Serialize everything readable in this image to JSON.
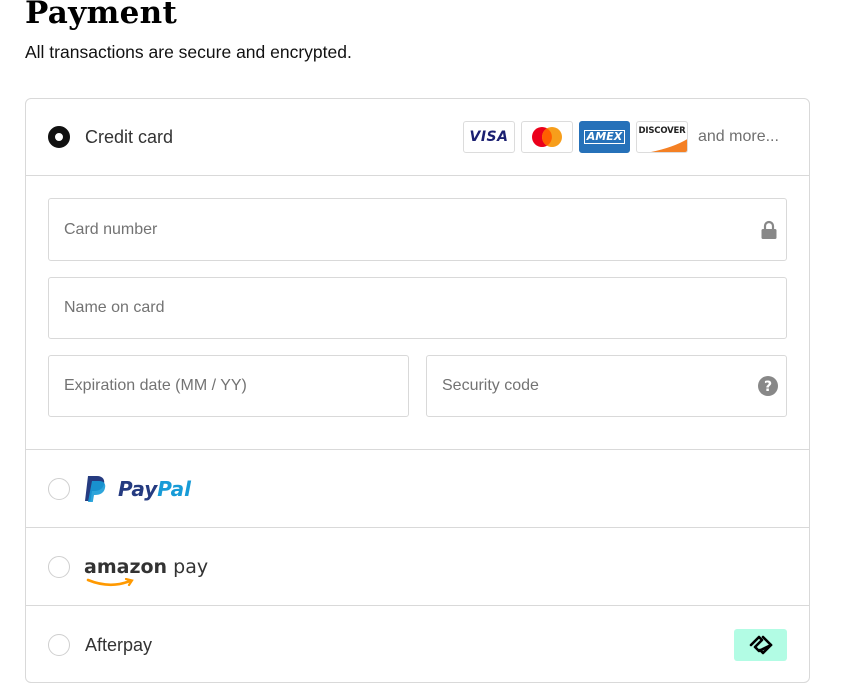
{
  "header": {
    "title": "Payment",
    "subtitle": "All transactions are secure and encrypted."
  },
  "credit_card": {
    "label": "Credit card",
    "card_brands": [
      "VISA",
      "Mastercard",
      "AMEX",
      "DISCOVER"
    ],
    "visa_text": "VISA",
    "amex_text": "AMEX",
    "discover_text": "DISCOVER",
    "and_more": "and more...",
    "fields": {
      "card_number_placeholder": "Card number",
      "name_placeholder": "Name on card",
      "expiry_placeholder": "Expiration date (MM / YY)",
      "security_placeholder": "Security code"
    }
  },
  "paypal": {
    "pay_text": "Pay",
    "pal_text": "Pal"
  },
  "amazon_pay": {
    "amazon_text": "amazon",
    "pay_text": " pay"
  },
  "afterpay": {
    "label": "Afterpay"
  },
  "colors": {
    "selected_radio": "#111111",
    "border": "#d9d9d9",
    "paypal_dark": "#253b80",
    "paypal_light": "#179bd7",
    "afterpay_mint": "#b2fce4",
    "amex_blue": "#2671b9",
    "discover_orange": "#f48024"
  }
}
